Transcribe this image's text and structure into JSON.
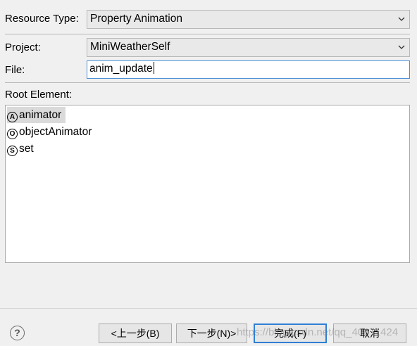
{
  "form": {
    "resource_type_label": "Resource Type:",
    "resource_type_value": "Property Animation",
    "project_label": "Project:",
    "project_value": "MiniWeatherSelf",
    "file_label": "File:",
    "file_value": "anim_update",
    "root_element_label": "Root Element:"
  },
  "root_elements": [
    {
      "badge": "A",
      "label": "animator",
      "selected": true
    },
    {
      "badge": "O",
      "label": "objectAnimator",
      "selected": false
    },
    {
      "badge": "S",
      "label": "set",
      "selected": false
    }
  ],
  "buttons": {
    "back": "<上一步(B)",
    "next": "下一步(N)>",
    "finish": "完成(F)",
    "cancel": "取消"
  },
  "help_glyph": "?",
  "watermark": "https://blog.csdn.net/qq_40611424",
  "icons": [
    "chevron-down-icon",
    "help-icon",
    "annotation-badge-icon"
  ]
}
